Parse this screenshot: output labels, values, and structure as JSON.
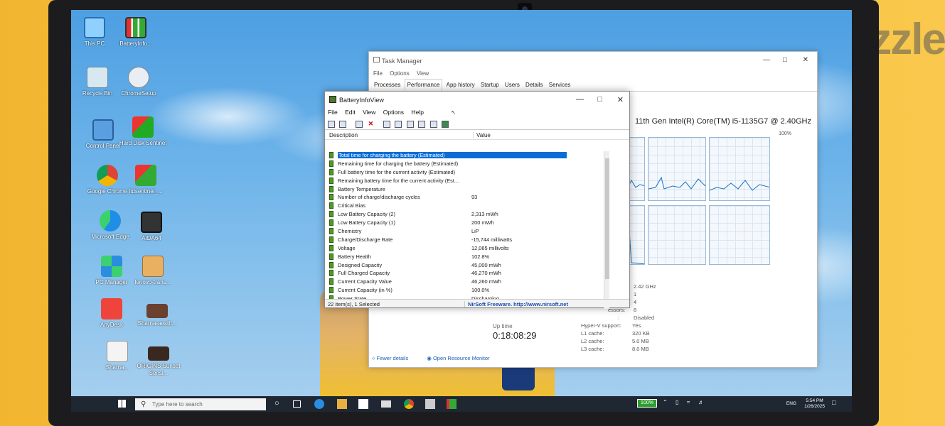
{
  "watermark": "dubizzle",
  "desktop": {
    "icons": [
      {
        "label": "This PC"
      },
      {
        "label": "BatteryInfo..."
      },
      {
        "label": "Recycle Bin"
      },
      {
        "label": "ChromeSetup"
      },
      {
        "label": "Control Panel"
      },
      {
        "label": "Hard Disk Sentinel"
      },
      {
        "label": "Google Chrome"
      },
      {
        "label": "ltdsentinel_..."
      },
      {
        "label": "Microsoft Edge"
      },
      {
        "label": "AIDA64"
      },
      {
        "label": "PC Manager"
      },
      {
        "label": "lenovo-trans..."
      },
      {
        "label": "AnyDesk"
      },
      {
        "label": "Sharna-aesth..."
      },
      {
        "label": "Sharna..."
      },
      {
        "label": "ORIGINS Sunset Sensi..."
      }
    ]
  },
  "task_manager": {
    "title": "Task Manager",
    "menu": [
      "File",
      "Options",
      "View"
    ],
    "tabs": [
      "Processes",
      "Performance",
      "App history",
      "Startup",
      "Users",
      "Details",
      "Services"
    ],
    "active_tab": "Performance",
    "cpu_name": "11th Gen Intel(R) Core(TM) i5-1135G7 @ 2.40GHz",
    "graph_max": "100%",
    "specs": [
      {
        "label": "",
        "value": "2.42 GHz"
      },
      {
        "label": "",
        "value": "1"
      },
      {
        "label": "",
        "value": "4"
      },
      {
        "label": "essors:",
        "value": "8"
      },
      {
        "label": ":",
        "value": "Disabled"
      },
      {
        "label": "Hyper-V support:",
        "value": "Yes"
      },
      {
        "label": "L1 cache:",
        "value": "320 KB"
      },
      {
        "label": "L2 cache:",
        "value": "5.0 MB"
      },
      {
        "label": "L3 cache:",
        "value": "8.0 MB"
      }
    ],
    "uptime_label": "Up time",
    "uptime": "0:18:08:29",
    "footer": {
      "fewer_details": "Fewer details",
      "open_monitor": "Open Resource Monitor"
    }
  },
  "battery_info_view": {
    "title": "BatteryInfoView",
    "menu": [
      "File",
      "Edit",
      "View",
      "Options",
      "Help"
    ],
    "col_description": "Description",
    "col_value": "Value",
    "rows": [
      {
        "desc": "Total  time for charging the battery (Estimated)",
        "value": "",
        "selected": true
      },
      {
        "desc": "Remaining time for charging the battery (Estimated)",
        "value": ""
      },
      {
        "desc": "Full battery time for the current activity (Estimated)",
        "value": ""
      },
      {
        "desc": "Remaining battery time for the current activity (Est...",
        "value": ""
      },
      {
        "desc": "Battery Temperature",
        "value": ""
      },
      {
        "desc": "Number of charge/discharge cycles",
        "value": "93"
      },
      {
        "desc": "Critical Bias",
        "value": ""
      },
      {
        "desc": "Low Battery Capacity (2)",
        "value": "2,313 mWh"
      },
      {
        "desc": "Low Battery Capacity (1)",
        "value": "200 mWh"
      },
      {
        "desc": "Chemistry",
        "value": "LiP"
      },
      {
        "desc": "Charge/Discharge Rate",
        "value": "-15,744 milliwatts"
      },
      {
        "desc": "Voltage",
        "value": "12,065 millivolts"
      },
      {
        "desc": "Battery Health",
        "value": "102.8%"
      },
      {
        "desc": "Designed Capacity",
        "value": "45,000 mWh"
      },
      {
        "desc": "Full Charged Capacity",
        "value": "46,270 mWh"
      },
      {
        "desc": "Current Capacity Value",
        "value": "46,260 mWh"
      },
      {
        "desc": "Current Capacity (in %)",
        "value": "100.0%"
      },
      {
        "desc": "Power State",
        "value": "Discharging"
      }
    ],
    "status_count": "22 item(s), 1 Selected",
    "status_link": "NirSoft Freeware.  http://www.nirsoft.net"
  },
  "taskbar": {
    "search_placeholder": "Type here to search",
    "battery": "100%",
    "language": "ENG",
    "time": "5:54 PM",
    "date": "1/26/2025"
  },
  "colors": {
    "selection": "#0a6dd6",
    "taskbar": "#1f2733",
    "battery_green": "#4e9a22"
  }
}
